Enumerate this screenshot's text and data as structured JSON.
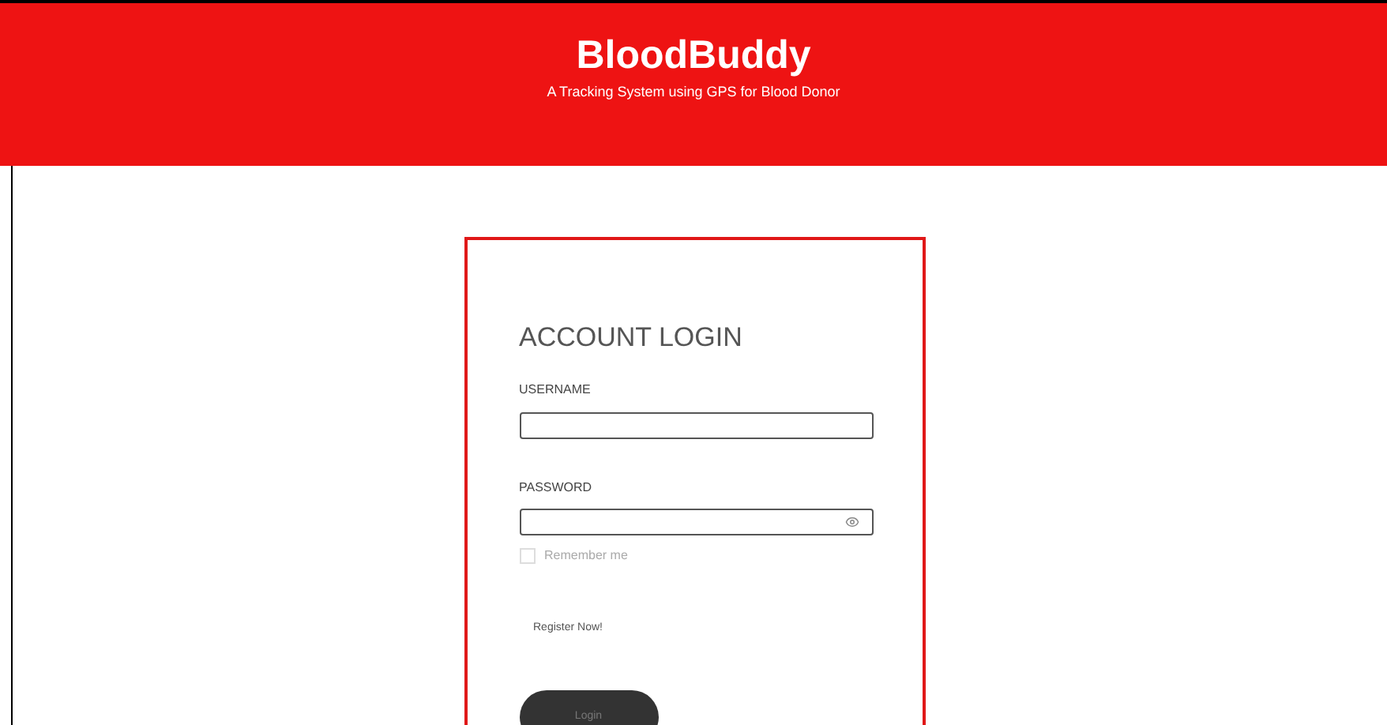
{
  "header": {
    "title": "BloodBuddy",
    "subtitle": "A Tracking System using GPS for Blood Donor"
  },
  "login": {
    "heading": "ACCOUNT LOGIN",
    "username": {
      "label": "USERNAME"
    },
    "password": {
      "label": "PASSWORD"
    },
    "remember": {
      "label": "Remember me",
      "checked": false
    },
    "register_link": "Register Now!",
    "submit": "Login"
  }
}
